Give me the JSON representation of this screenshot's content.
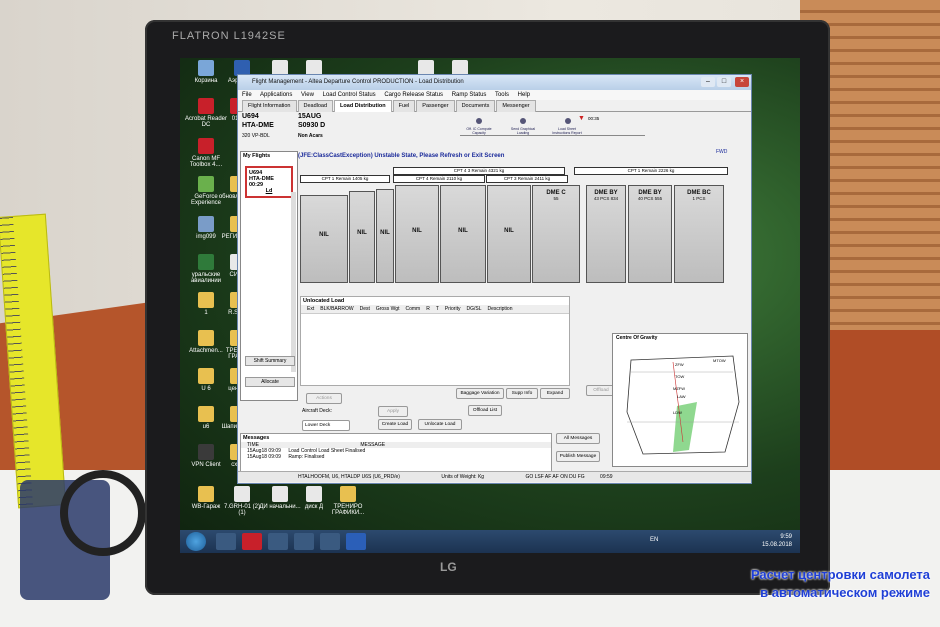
{
  "monitor": {
    "brand": "FLATRON L1942SE",
    "logo": "LG"
  },
  "desktop_icons": [
    {
      "label": "Корзина",
      "color": "#7aa6d8"
    },
    {
      "label": "Аэрофлот",
      "color": "#2f5fb0"
    },
    {
      "label": "ОБРАЗЕЦ",
      "color": "#e8e8e8"
    },
    {
      "label": "output -",
      "color": "#e8e8e8"
    },
    {
      "label": "ЗАЯВЛЕНИЕ",
      "color": "#e8e8e8"
    },
    {
      "label": "ЗАЯВЛЕНИЕ",
      "color": "#e8e8e8"
    },
    {
      "label": "Acrobat Reader DC",
      "color": "#c8202a"
    },
    {
      "label": "0111",
      "color": "#c8202a"
    },
    {
      "label": "Canon MF Toolbox 4....",
      "color": "#c8202a"
    },
    {
      "label": "GeForce Experience",
      "color": "#6ab04c"
    },
    {
      "label": "обновл 17.3.2",
      "color": "#e8c050"
    },
    {
      "label": "img099",
      "color": "#7a9cc8"
    },
    {
      "label": "РЕГИСТ СТ",
      "color": "#e8c050"
    },
    {
      "label": "уральские авиалинии",
      "color": "#2f7a3a"
    },
    {
      "label": "СИБИ",
      "color": "#e8e8e8"
    },
    {
      "label": "1",
      "color": "#e8c050"
    },
    {
      "label": "R.Spay",
      "color": "#e8c050"
    },
    {
      "label": "Attachmen...",
      "color": "#e8c050"
    },
    {
      "label": "ТРЕНИР ГРАФИ",
      "color": "#e8c050"
    },
    {
      "label": "U 6",
      "color": "#e8c050"
    },
    {
      "label": "центро",
      "color": "#e8c050"
    },
    {
      "label": "u6",
      "color": "#e8c050"
    },
    {
      "label": "Шапи прете",
      "color": "#e8c050"
    },
    {
      "label": "VPN Client",
      "color": "#3a3a3a"
    },
    {
      "label": "схем",
      "color": "#e8c050"
    },
    {
      "label": "WB-Гараж",
      "color": "#e8c050"
    },
    {
      "label": "7.GRH-01 (2) (1)",
      "color": "#e8e8e8"
    },
    {
      "label": "ДИ начальни...",
      "color": "#e8e8e8"
    },
    {
      "label": "диск Д",
      "color": "#e8e8e8"
    },
    {
      "label": "ТРЕНИРО ГРАФИКИ...",
      "color": "#e8c050"
    }
  ],
  "window": {
    "title": "Flight Management - Altea Departure Control PRODUCTION - Load Distribution",
    "menu": [
      "File",
      "Applications",
      "View",
      "Load Control Status",
      "Cargo Release Status",
      "Ramp Status",
      "Tools",
      "Help"
    ],
    "tabs": [
      "Flight Information",
      "Deadload",
      "Load Distribution",
      "Fuel",
      "Passenger",
      "Documents",
      "Messenger"
    ],
    "active_tab": "Load Distribution",
    "flight": {
      "number": "U694",
      "date": "15AUG",
      "route": "HTA-DME",
      "std": "S0930 D",
      "aircraft": "320 VP-BDL",
      "acars": "Non Acars"
    },
    "status_time": "00:35",
    "status_steps": [
      "Off. IC Compute Capacity",
      "Send Graphical Loading",
      "Load Sheet Instructions Report"
    ],
    "my_flights_label": "My Flights",
    "flight_card": {
      "line1": "U694",
      "line2": "HTA-DME",
      "line3": "00:29",
      "line4": "Ld"
    },
    "shift_summary": "Shift Summary",
    "allocate": "Allocate",
    "error": "(JFE:ClassCastException) Unstable State, Please Refresh or Exit Screen",
    "fwd": "FWD",
    "bars": {
      "cpt4": "CPT 4 3 Remain 4321 kg",
      "cpt1_5": "CPT 1 Remain 1405 kg",
      "cpt4_2": "CPT 4 Remain 2110 kg",
      "cpt3": "CPT 3 Remain 2411 kg",
      "cpt1": "CPT 1 Remain 2226 kg"
    },
    "holds": [
      {
        "label": "NIL"
      },
      {
        "label": "NIL"
      },
      {
        "label": "NIL"
      },
      {
        "label": "NIL"
      },
      {
        "label": "NIL"
      },
      {
        "label": "NIL"
      },
      {
        "label": "DME C",
        "sub": "55"
      },
      {
        "label": "DME BY",
        "sub": "43 PCS 834"
      },
      {
        "label": "DME BY",
        "sub": "40 PCS 555"
      },
      {
        "label": "DME BC",
        "sub": "1 PCS"
      }
    ],
    "unlocated": {
      "title": "Unlocated Load",
      "columns": [
        "Ext",
        "BLK/BARROW",
        "Dest",
        "Gross Wgt",
        "Comm",
        "R",
        "T",
        "Priority",
        "DG/SL",
        "Description"
      ]
    },
    "buttons": {
      "baggage_variation": "Baggage Variation",
      "supp_info": "Supp Info",
      "expand": "Expand",
      "offload": "Offload",
      "actions": "Actions",
      "aircraft_deck": "Aircraft Deck:",
      "lower_deck": "Lower Deck",
      "apply": "Apply",
      "create_load": "Create Load",
      "unlocate_load": "Unlocate Load",
      "offload_list": "Offload List",
      "all_messages": "All Messages",
      "publish_message": "Publish Message"
    },
    "messages": {
      "title": "Messages",
      "header_time": "TIME",
      "header_message": "MESSAGE",
      "rows": [
        {
          "time": "15Aug18 09:09",
          "text": "Load Control Load Sheet Finalised"
        },
        {
          "time": "15Aug18 09:09",
          "text": "Ramp: Finalised"
        }
      ]
    },
    "cog": {
      "title": "Centre Of Gravity",
      "labels": [
        "ZFW",
        "TOW",
        "MTOW",
        "LAW",
        "MZFW",
        "LDW"
      ]
    },
    "status_bar": {
      "left": "HTALHOOFM, U6, HTALDP U6S (U6_PRD/e)",
      "units": "Units of Weight: Kg",
      "codes": "GO LSF AF AF ON DU FG",
      "time": "09:59"
    }
  },
  "taskbar": {
    "lang": "EN",
    "time": "9:59",
    "date": "15.08.2018"
  },
  "caption": {
    "line1": "Расчет центровки самолета",
    "line2": "в автоматическом режиме"
  }
}
